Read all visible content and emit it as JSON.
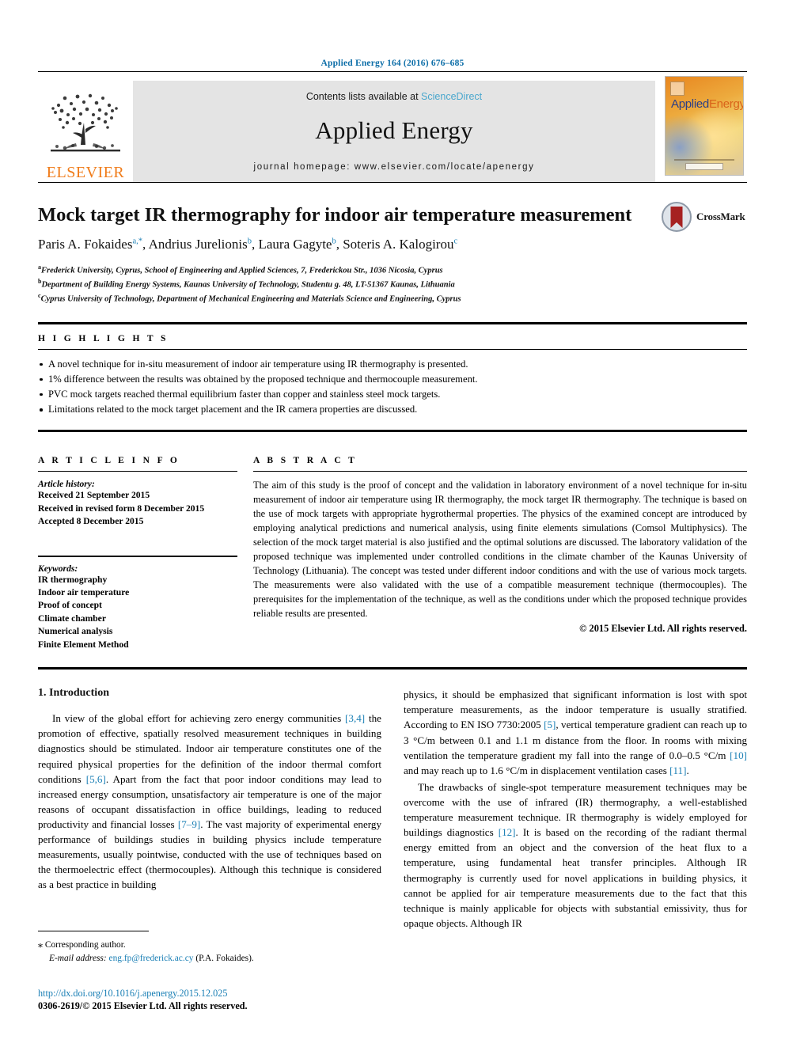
{
  "running_head": "Applied Energy 164 (2016) 676–685",
  "masthead": {
    "publisher_name": "ELSEVIER",
    "contents_prefix": "Contents lists available at ",
    "contents_link": "ScienceDirect",
    "journal_name": "Applied Energy",
    "homepage": "journal homepage: www.elsevier.com/locate/apenergy",
    "cover_title_1": "Applied",
    "cover_title_2": "Energy"
  },
  "article": {
    "title": "Mock target IR thermography for indoor air temperature measurement",
    "authors": [
      {
        "name": "Paris A. Fokaides",
        "sup": "a,*"
      },
      {
        "name": "Andrius Jurelionis",
        "sup": "b"
      },
      {
        "name": "Laura Gagyte",
        "sup": "b"
      },
      {
        "name": "Soteris A. Kalogirou",
        "sup": "c"
      }
    ],
    "affiliations": [
      {
        "mark": "a",
        "text": "Frederick University, Cyprus, School of Engineering and Applied Sciences, 7, Frederickou Str., 1036 Nicosia, Cyprus"
      },
      {
        "mark": "b",
        "text": "Department of Building Energy Systems, Kaunas University of Technology, Studentu g. 48, LT-51367 Kaunas, Lithuania"
      },
      {
        "mark": "c",
        "text": "Cyprus University of Technology, Department of Mechanical Engineering and Materials Science and Engineering, Cyprus"
      }
    ],
    "crossmark_label": "CrossMark"
  },
  "highlights": {
    "label": "H I G H L I G H T S",
    "items": [
      "A novel technique for in-situ measurement of indoor air temperature using IR thermography is presented.",
      "1% difference between the results was obtained by the proposed technique and thermocouple measurement.",
      "PVC mock targets reached thermal equilibrium faster than copper and stainless steel mock targets.",
      "Limitations related to the mock target placement and the IR camera properties are discussed."
    ]
  },
  "article_info": {
    "label": "A R T I C L E    I N F O",
    "history_head": "Article history:",
    "history": [
      "Received 21 September 2015",
      "Received in revised form 8 December 2015",
      "Accepted 8 December 2015"
    ],
    "keywords_head": "Keywords:",
    "keywords": [
      "IR thermography",
      "Indoor air temperature",
      "Proof of concept",
      "Climate chamber",
      "Numerical analysis",
      "Finite Element Method"
    ]
  },
  "abstract": {
    "label": "A B S T R A C T",
    "text": "The aim of this study is the proof of concept and the validation in laboratory environment of a novel technique for in-situ measurement of indoor air temperature using IR thermography, the mock target IR thermography. The technique is based on the use of mock targets with appropriate hygrothermal properties. The physics of the examined concept are introduced by employing analytical predictions and numerical analysis, using finite elements simulations (Comsol Multiphysics). The selection of the mock target material is also justified and the optimal solutions are discussed. The laboratory validation of the proposed technique was implemented under controlled conditions in the climate chamber of the Kaunas University of Technology (Lithuania). The concept was tested under different indoor conditions and with the use of various mock targets. The measurements were also validated with the use of a compatible measurement technique (thermocouples). The prerequisites for the implementation of the technique, as well as the conditions under which the proposed technique provides reliable results are presented.",
    "copyright": "© 2015 Elsevier Ltd. All rights reserved."
  },
  "body": {
    "section_heading": "1. Introduction",
    "left_paragraphs": [
      "In view of the global effort for achieving zero energy communities [3,4] the promotion of effective, spatially resolved measurement techniques in building diagnostics should be stimulated. Indoor air temperature constitutes one of the required physical properties for the definition of the indoor thermal comfort conditions [5,6]. Apart from the fact that poor indoor conditions may lead to increased energy consumption, unsatisfactory air temperature is one of the major reasons of occupant dissatisfaction in office buildings, leading to reduced productivity and financial losses [7–9]. The vast majority of experimental energy performance of buildings studies in building physics include temperature measurements, usually pointwise, conducted with the use of techniques based on the thermoelectric effect (thermocouples). Although this technique is considered as a best practice in building"
    ],
    "right_paragraphs": [
      "physics, it should be emphasized that significant information is lost with spot temperature measurements, as the indoor temperature is usually stratified. According to EN ISO 7730:2005 [5], vertical temperature gradient can reach up to 3 °C/m between 0.1 and 1.1 m distance from the floor. In rooms with mixing ventilation the temperature gradient my fall into the range of 0.0–0.5 °C/m [10] and may reach up to 1.6 °C/m in displacement ventilation cases [11].",
      "The drawbacks of single-spot temperature measurement techniques may be overcome with the use of infrared (IR) thermography, a well-established temperature measurement technique. IR thermography is widely employed for buildings diagnostics [12]. It is based on the recording of the radiant thermal energy emitted from an object and the conversion of the heat flux to a temperature, using fundamental heat transfer principles. Although IR thermography is currently used for novel applications in building physics, it cannot be applied for air temperature measurements due to the fact that this technique is mainly applicable for objects with substantial emissivity, thus for opaque objects. Although IR"
    ]
  },
  "footer": {
    "corresponding_star": "⁎",
    "corresponding_text": "Corresponding author.",
    "email_label": "E-mail address:",
    "email": "eng.fp@frederick.ac.cy",
    "email_suffix": "(P.A. Fokaides).",
    "doi": "http://dx.doi.org/10.1016/j.apenergy.2015.12.025",
    "issn_line": "0306-2619/© 2015 Elsevier Ltd. All rights reserved."
  },
  "colors": {
    "link_blue": "#1a7fb5",
    "sciencedirect_blue": "#4aa7cd",
    "elsevier_orange": "#f07c1a",
    "crossmark_red": "#a62121"
  }
}
